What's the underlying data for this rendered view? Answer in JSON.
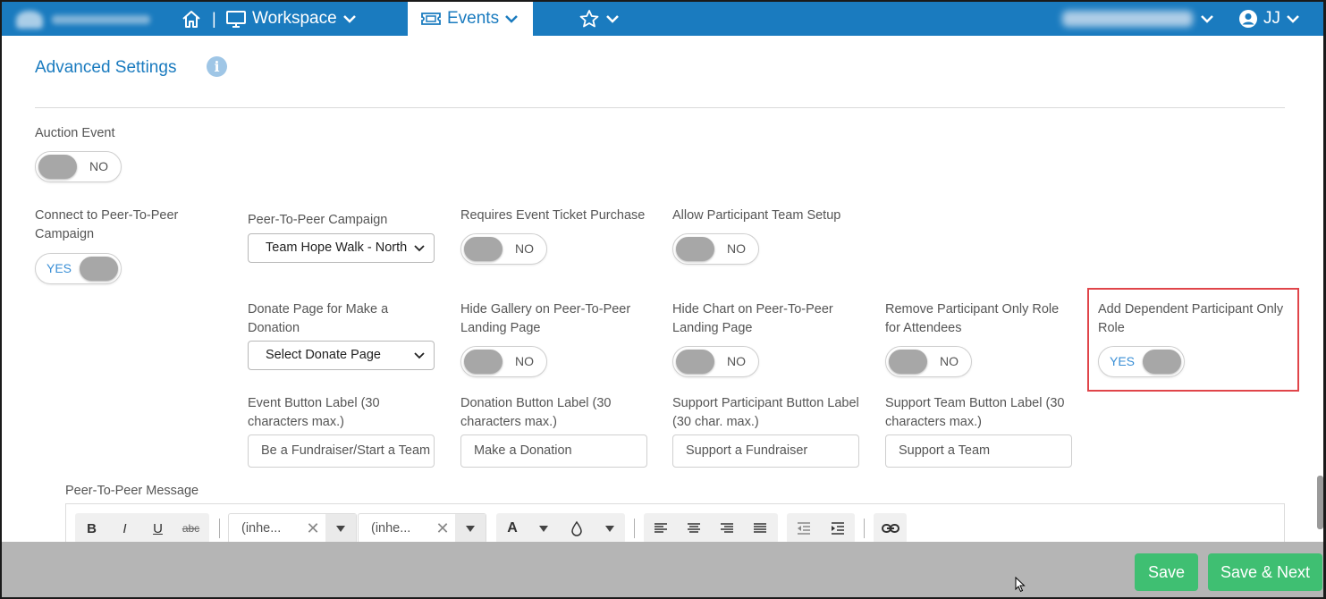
{
  "nav": {
    "workspace_label": "Workspace",
    "events_label": "Events",
    "user_initials": "JJ",
    "divider": "|"
  },
  "section": {
    "title": "Advanced Settings"
  },
  "fields": {
    "auction_event": {
      "label": "Auction Event",
      "toggle": "NO"
    },
    "connect_p2p": {
      "label": "Connect to Peer-To-Peer Campaign",
      "toggle": "YES"
    },
    "p2p_campaign": {
      "label": "Peer-To-Peer Campaign",
      "value": "Team Hope Walk - North"
    },
    "requires_ticket": {
      "label": "Requires Event Ticket Purchase",
      "toggle": "NO"
    },
    "allow_team_setup": {
      "label": "Allow Participant Team Setup",
      "toggle": "NO"
    },
    "donate_page": {
      "label": "Donate Page for Make a Donation",
      "value": "Select Donate Page"
    },
    "hide_gallery": {
      "label": "Hide Gallery on Peer-To-Peer Landing Page",
      "toggle": "NO"
    },
    "hide_chart": {
      "label": "Hide Chart on Peer-To-Peer Landing Page",
      "toggle": "NO"
    },
    "remove_participant_role": {
      "label": "Remove Participant Only Role for Attendees",
      "toggle": "NO"
    },
    "add_dependent_role": {
      "label": "Add Dependent Participant Only Role",
      "toggle": "YES"
    },
    "event_button_label": {
      "label": "Event Button Label (30 characters max.)",
      "value": "Be a Fundraiser/Start a Team"
    },
    "donation_button_label": {
      "label": "Donation Button Label (30 characters max.)",
      "value": "Make a Donation"
    },
    "support_participant_label": {
      "label": "Support Participant Button Label (30 char. max.)",
      "value": "Support a Fundraiser"
    },
    "support_team_label": {
      "label": "Support Team Button Label (30 characters max.)",
      "value": "Support a Team"
    }
  },
  "editor": {
    "label": "Peer-To-Peer Message",
    "bold": "B",
    "italic": "I",
    "underline": "U",
    "strike": "abc",
    "font_family": "(inhe...",
    "font_size": "(inhe...",
    "font_color": "A"
  },
  "footer": {
    "save_label": "Save",
    "save_next_label": "Save & Next"
  },
  "colors": {
    "nav_blue": "#1a7bbf",
    "green": "#3fbf72",
    "highlight_red": "#e0454a"
  }
}
